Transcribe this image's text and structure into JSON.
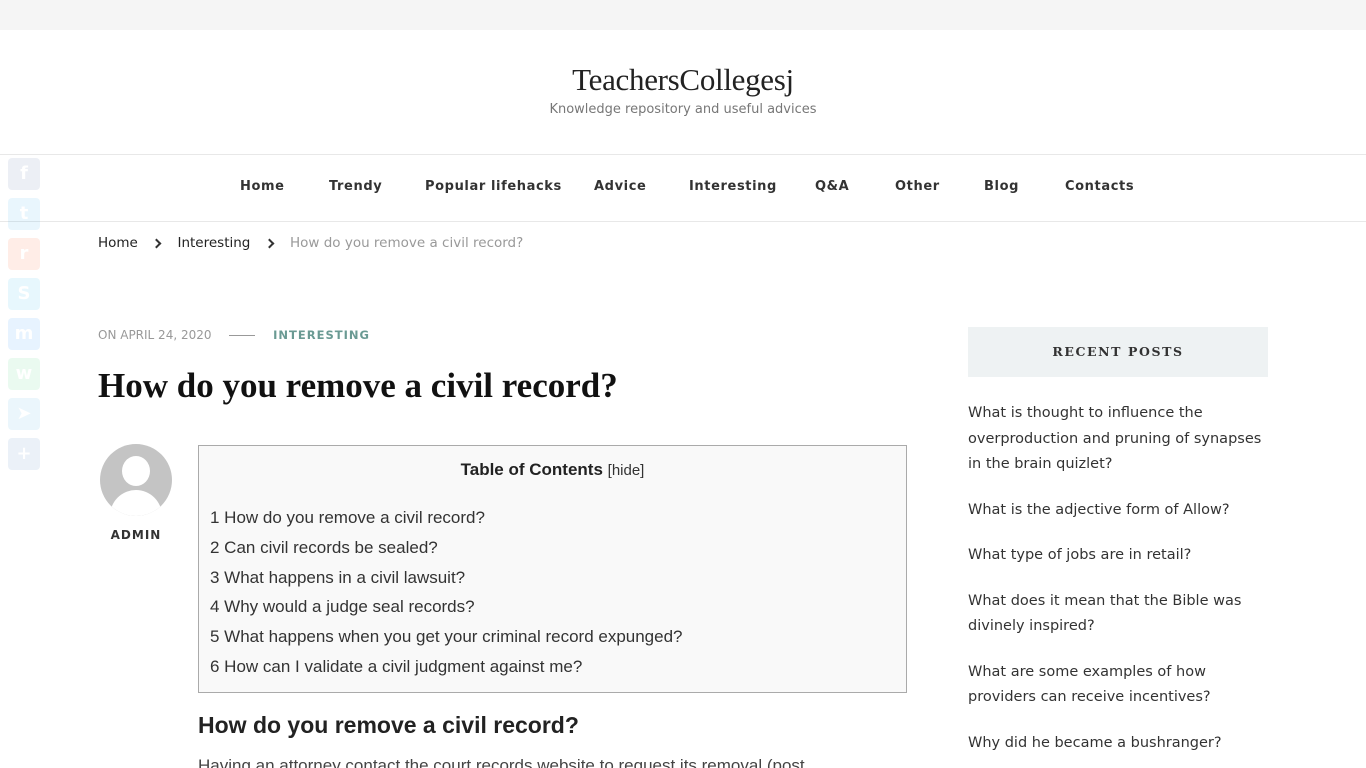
{
  "site": {
    "title": "TeachersCollegesj",
    "tagline": "Knowledge repository and useful advices"
  },
  "nav": {
    "items": [
      "Home",
      "Trendy",
      "Popular lifehacks",
      "Advice",
      "Interesting",
      "Q&A",
      "Other",
      "Blog",
      "Contacts"
    ]
  },
  "breadcrumb": {
    "home": "Home",
    "category": "Interesting",
    "current": "How do you remove a civil record?"
  },
  "post": {
    "date": "ON APRIL 24, 2020",
    "category": "INTERESTING",
    "title": "How do you remove a civil record?",
    "author": "ADMIN",
    "section_heading": "How do you remove a civil record?",
    "body_start": "Having an attorney contact the court records website to request its removal (post"
  },
  "toc": {
    "title": "Table of Contents",
    "toggle": "[hide]",
    "items": [
      "1 How do you remove a civil record?",
      "2 Can civil records be sealed?",
      "3 What happens in a civil lawsuit?",
      "4 Why would a judge seal records?",
      "5 What happens when you get your criminal record expunged?",
      "6 How can I validate a civil judgment against me?"
    ]
  },
  "sidebar": {
    "title": "RECENT POSTS",
    "posts": [
      "What is thought to influence the overproduction and pruning of synapses in the brain quizlet?",
      "What is the adjective form of Allow?",
      "What type of jobs are in retail?",
      "What does it mean that the Bible was divinely inspired?",
      "What are some examples of how providers can receive incentives?",
      "Why did he became a bushranger?"
    ]
  },
  "share": {
    "buttons": [
      {
        "icon": "facebook-icon",
        "glyph": "f",
        "color": "#3b5998"
      },
      {
        "icon": "twitter-icon",
        "glyph": "t",
        "color": "#1da1f2"
      },
      {
        "icon": "reddit-icon",
        "glyph": "r",
        "color": "#ff4500"
      },
      {
        "icon": "skype-icon",
        "glyph": "S",
        "color": "#00aff0"
      },
      {
        "icon": "messenger-icon",
        "glyph": "m",
        "color": "#0084ff"
      },
      {
        "icon": "whatsapp-icon",
        "glyph": "w",
        "color": "#25d366"
      },
      {
        "icon": "telegram-icon",
        "glyph": "➤",
        "color": "#2ca5e0"
      },
      {
        "icon": "share-plus-icon",
        "glyph": "+",
        "color": "#2a6ebb"
      }
    ]
  }
}
